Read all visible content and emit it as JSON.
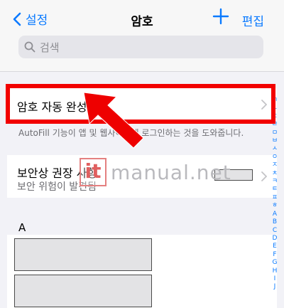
{
  "nav": {
    "back_label": "설정",
    "title": "암호",
    "edit_label": "편집"
  },
  "search": {
    "placeholder": "검색"
  },
  "autofill": {
    "title": "암호 자동 완성",
    "footnote": "AutoFill 기능이 앱 및 웹사이트에 로그인하는 것을 도와줍니다."
  },
  "security": {
    "title": "보안상 권장 사항",
    "subtitle": "보안 위험이 발견됨"
  },
  "watermark": {
    "badge": "it",
    "text": "manual.net"
  },
  "list": {
    "section_header": "A"
  },
  "index": [
    "ㄱ",
    "ㄴ",
    "ㄷ",
    "ㄹ",
    "ㅁ",
    "ㅂ",
    "ㅅ",
    "ㅇ",
    "ㅈ",
    "ㅊ",
    "ㅋ",
    "ㅌ",
    "ㅍ",
    "ㅎ",
    "A",
    "B",
    "C",
    "D",
    "E",
    "F",
    "G",
    "H",
    "I",
    "J"
  ],
  "colors": {
    "accent": "#0a7aff",
    "highlight": "#f20000"
  }
}
